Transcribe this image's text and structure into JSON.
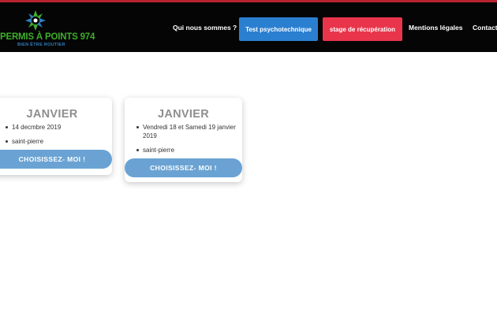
{
  "header": {
    "logo": {
      "title": "PERMIS À POINTS 974",
      "subtitle": "BIEN ÊTRE ROUTIER"
    },
    "nav": {
      "qui_nous_sommes": "Qui nous sommes ?",
      "test_psycho": "Test psychotechnique",
      "stage": "stage de récupération",
      "mentions": "Mentions légales",
      "contact": "Contact"
    },
    "colors": {
      "header_bg": "#050505",
      "top_line": "#b8222e",
      "blue_button": "#2b7fd0",
      "red_button": "#e8354b",
      "logo_green": "#3fae2a",
      "logo_blue": "#2e7fc2"
    }
  },
  "cards": [
    {
      "month": "JANVIER",
      "date": "14 decmbre 2019",
      "location": "saint-pierre",
      "button": "CHOISISSEZ- MOI !"
    },
    {
      "month": "JANVIER",
      "date_line1": "Vendredi 18 et Samedi 19 janvier",
      "date_line2": "2019",
      "location": "saint-pierre",
      "button": "CHOISISSEZ- MOI !"
    }
  ],
  "card_colors": {
    "title": "#8e8e8e",
    "button_bg": "#6aa3d3"
  }
}
